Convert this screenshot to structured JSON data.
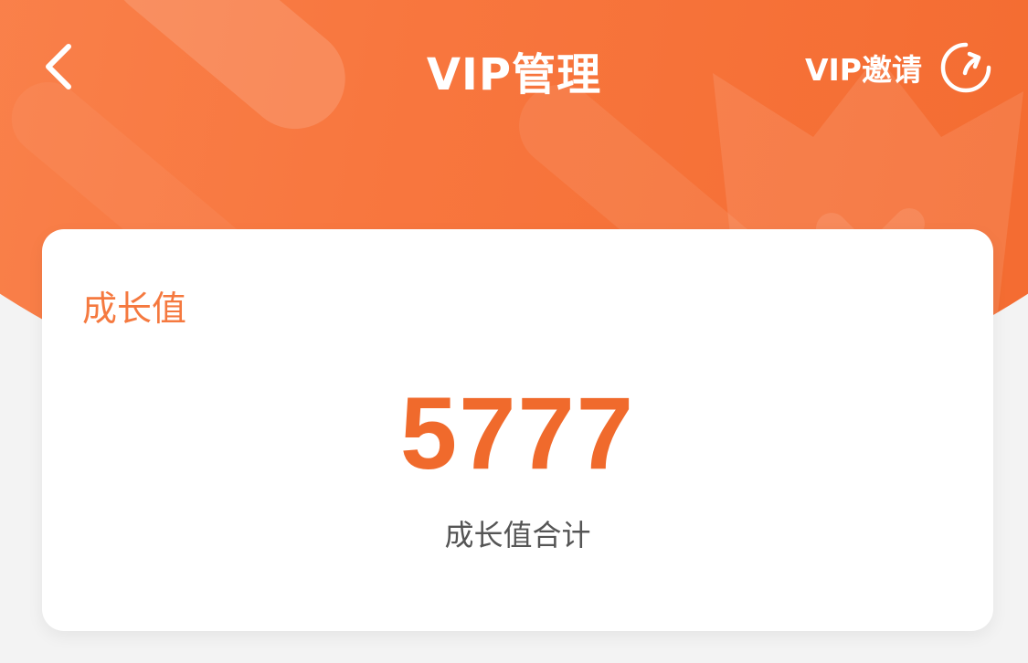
{
  "header": {
    "title": "VIP管理",
    "invite_label": "VIP邀请",
    "back_icon": "chevron-left-icon",
    "invite_icon": "refresh-icon"
  },
  "growth_card": {
    "title": "成长值",
    "value": "5777",
    "caption": "成长值合计"
  },
  "colors": {
    "header_gradient_start": "#fb8a56",
    "header_gradient_end": "#f2672b",
    "accent_text": "#f5793f",
    "value_text": "#f06a2c",
    "caption_text": "#555555",
    "page_background": "#f3f3f3",
    "card_background": "#ffffff"
  }
}
